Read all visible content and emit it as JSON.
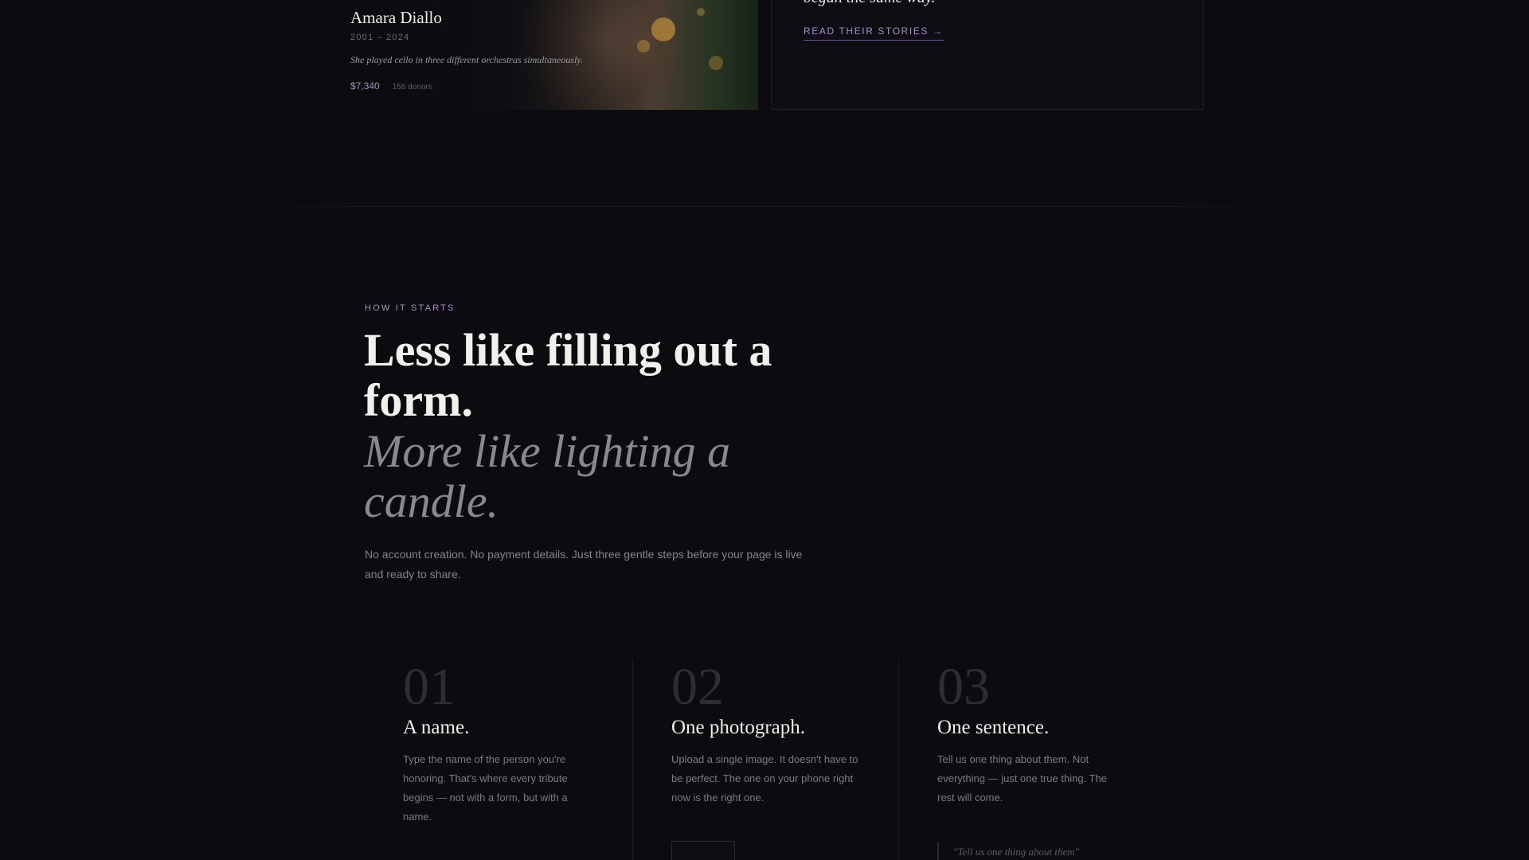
{
  "featured": {
    "name": "Amara Diallo",
    "years": "2001 – 2024",
    "quote": "She played cello in three different orchestras simultaneously.",
    "amount": "$7,340",
    "donors": "156 donors"
  },
  "stories": {
    "heading": "began the same way.",
    "link": "READ THEIR STORIES →"
  },
  "how_it_starts": {
    "eyebrow": "HOW IT STARTS",
    "title": "Less like filling out a form.",
    "subtitle": "More like lighting a candle.",
    "body": "No account creation. No payment details. Just three gentle steps before your page is live and ready to share."
  },
  "steps": [
    {
      "number": "01",
      "title": "A name.",
      "text": "Type the name of the person you're honoring. That's where every tribute begins — not with a form, but with a name."
    },
    {
      "number": "02",
      "title": "One photograph.",
      "text": "Upload a single image. It doesn't have to be perfect. The one on your phone right now is the right one."
    },
    {
      "number": "03",
      "title": "One sentence.",
      "text": "Tell us one thing about them. Not everything — just one true thing. The rest will come.",
      "example": "\"Tell us one thing about them\""
    }
  ]
}
